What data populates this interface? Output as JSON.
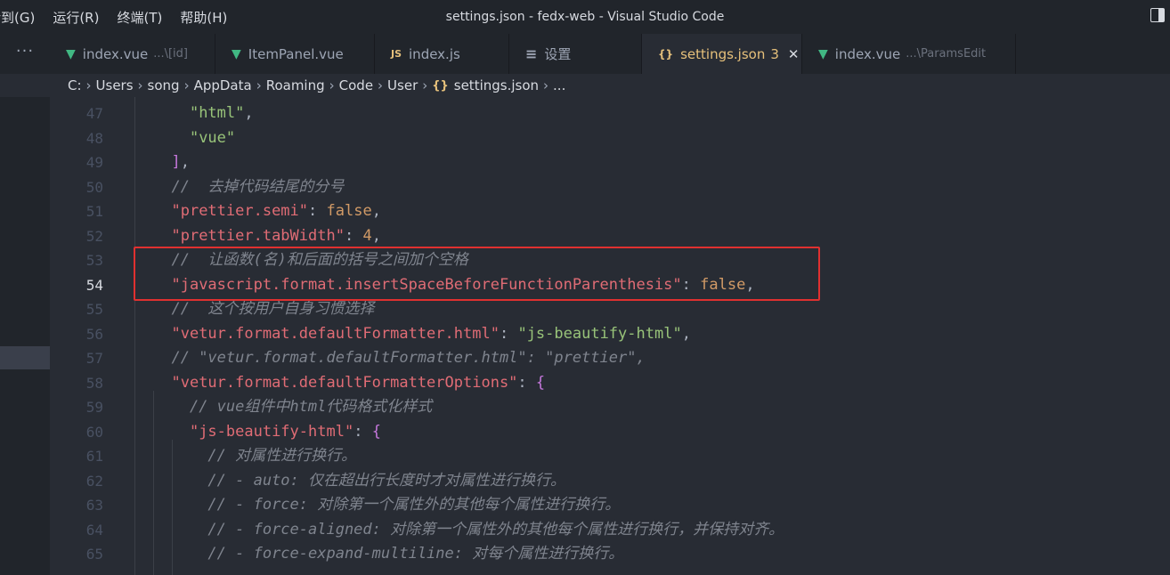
{
  "window": {
    "title": "settings.json - fedx-web - Visual Studio Code",
    "menu": [
      "转到(G)",
      "运行(R)",
      "终端(T)",
      "帮助(H)"
    ]
  },
  "tabs": [
    {
      "icon": "vue-icon",
      "label": "index.vue",
      "desc": "...\\[id]",
      "active": false
    },
    {
      "icon": "vue-icon",
      "label": "ItemPanel.vue",
      "desc": "",
      "active": false
    },
    {
      "icon": "js-icon",
      "label": "index.js",
      "desc": "",
      "active": false
    },
    {
      "icon": "settings-icon",
      "label": "设置",
      "desc": "",
      "active": false
    },
    {
      "icon": "json-icon",
      "label": "settings.json",
      "badge": "3",
      "active": true
    },
    {
      "icon": "vue-icon",
      "label": "index.vue",
      "desc": "...\\ParamsEdit",
      "active": false
    }
  ],
  "tab_more": "···",
  "icons": {
    "vue": "▼",
    "js": "JS",
    "json": "{}",
    "settings": "≡",
    "close": "✕"
  },
  "breadcrumb": [
    "C:",
    "Users",
    "song",
    "AppData",
    "Roaming",
    "Code",
    "User",
    "settings.json",
    "..."
  ],
  "editor": {
    "lines": [
      {
        "n": "47",
        "text": "    \"html\","
      },
      {
        "n": "48",
        "text": "    \"vue\""
      },
      {
        "n": "49",
        "text": "  ],"
      },
      {
        "n": "50",
        "text": "  //  去掉代码结尾的分号"
      },
      {
        "n": "51",
        "text": "  \"prettier.semi\": false,"
      },
      {
        "n": "52",
        "text": "  \"prettier.tabWidth\": 4,"
      },
      {
        "n": "53",
        "text": "  //  让函数(名)和后面的括号之间加个空格"
      },
      {
        "n": "54",
        "text": "  \"javascript.format.insertSpaceBeforeFunctionParenthesis\": false,",
        "current": true
      },
      {
        "n": "55",
        "text": "  //  这个按用户自身习惯选择"
      },
      {
        "n": "56",
        "text": "  \"vetur.format.defaultFormatter.html\": \"js-beautify-html\","
      },
      {
        "n": "57",
        "text": "  // \"vetur.format.defaultFormatter.html\": \"prettier\","
      },
      {
        "n": "58",
        "text": "  \"vetur.format.defaultFormatterOptions\": {"
      },
      {
        "n": "59",
        "text": "    // vue组件中html代码格式化样式"
      },
      {
        "n": "60",
        "text": "    \"js-beautify-html\": {"
      },
      {
        "n": "61",
        "text": "      // 对属性进行换行。"
      },
      {
        "n": "62",
        "text": "      // - auto: 仅在超出行长度时才对属性进行换行。"
      },
      {
        "n": "63",
        "text": "      // - force: 对除第一个属性外的其他每个属性进行换行。"
      },
      {
        "n": "64",
        "text": "      // - force-aligned: 对除第一个属性外的其他每个属性进行换行，并保持对齐。"
      },
      {
        "n": "65",
        "text": "      // - force-expand-multiline: 对每个属性进行换行。"
      }
    ]
  }
}
